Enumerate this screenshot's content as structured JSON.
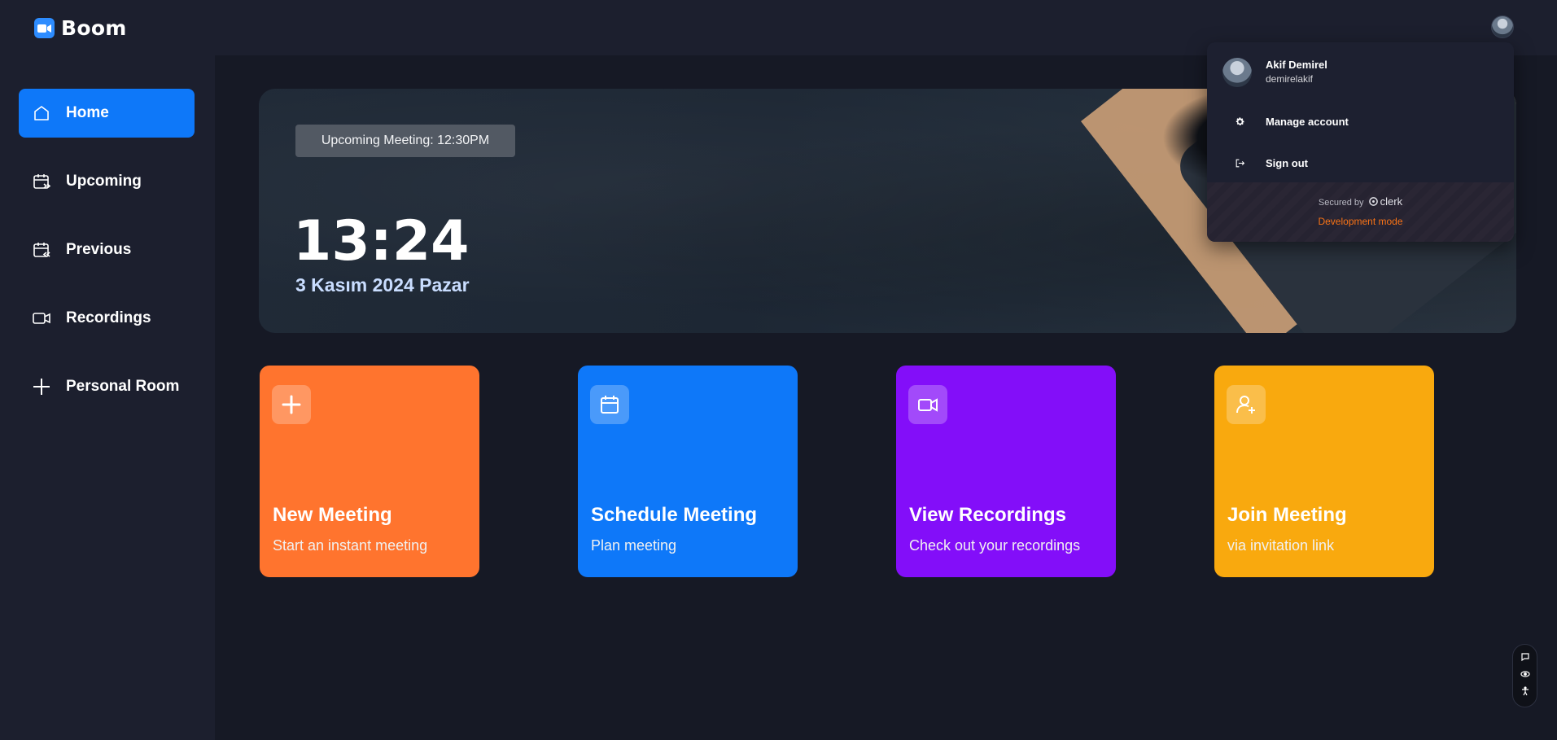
{
  "app": {
    "name": "Boom",
    "accent": "#0e78f9"
  },
  "sidebar": {
    "items": [
      {
        "label": "Home",
        "icon": "home-icon",
        "active": true
      },
      {
        "label": "Upcoming",
        "icon": "calendar-upcoming-icon"
      },
      {
        "label": "Previous",
        "icon": "calendar-previous-icon"
      },
      {
        "label": "Recordings",
        "icon": "video-icon"
      },
      {
        "label": "Personal Room",
        "icon": "plus-icon"
      }
    ]
  },
  "hero": {
    "badge": "Upcoming Meeting: 12:30PM",
    "time": "13:24",
    "date": "3 Kasım 2024 Pazar"
  },
  "cards": [
    {
      "title": "New Meeting",
      "subtitle": "Start an instant meeting",
      "icon": "plus-icon",
      "color": "#ff742e"
    },
    {
      "title": "Schedule Meeting",
      "subtitle": "Plan meeting",
      "icon": "calendar-icon",
      "color": "#0e78f9"
    },
    {
      "title": "View Recordings",
      "subtitle": "Check out your recordings",
      "icon": "video-icon",
      "color": "#830ef9"
    },
    {
      "title": "Join Meeting",
      "subtitle": "via invitation link",
      "icon": "add-user-icon",
      "color": "#f9a90e"
    }
  ],
  "user_menu": {
    "name": "Akif Demirel",
    "username": "demirelakif",
    "manage_label": "Manage account",
    "signout_label": "Sign out",
    "secured_by": "Secured by",
    "provider": "clerk",
    "dev_mode": "Development mode"
  }
}
